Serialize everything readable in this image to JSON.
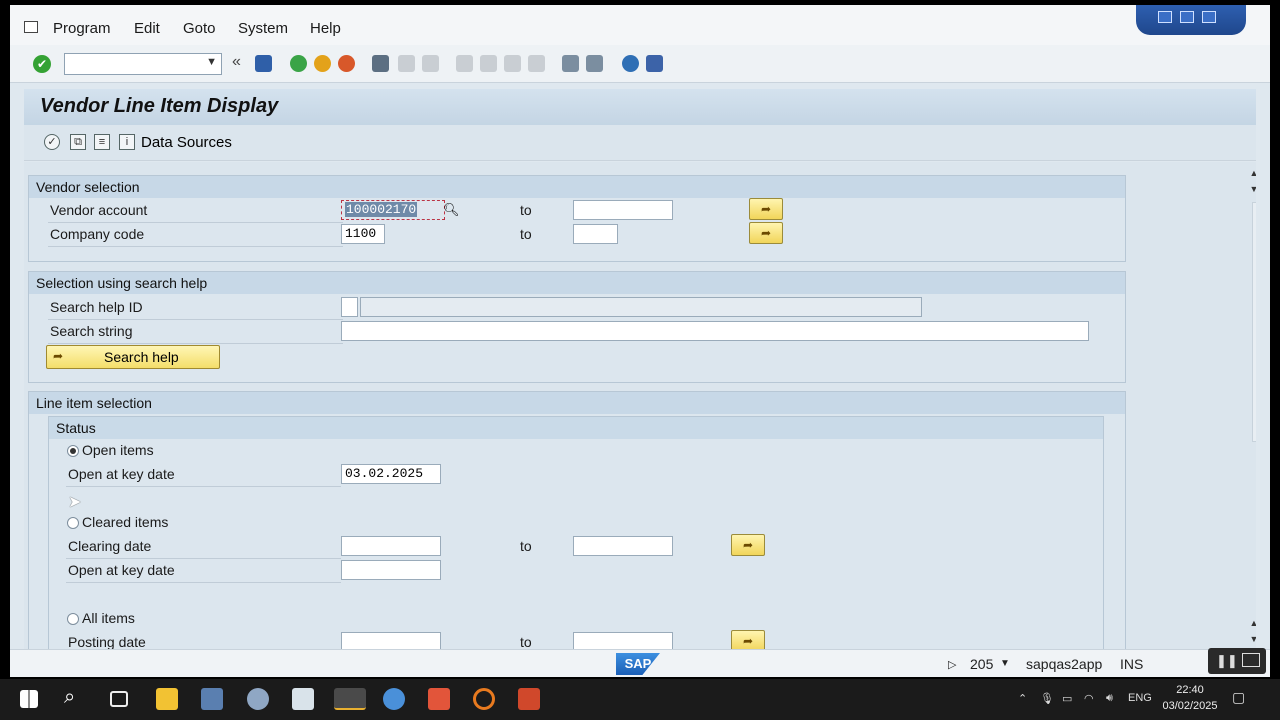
{
  "menu": {
    "items": [
      "Program",
      "Edit",
      "Goto",
      "System",
      "Help"
    ]
  },
  "toolbar": {
    "command_value": "",
    "back_symbol": "«"
  },
  "title": "Vendor Line Item Display",
  "appbar": {
    "data_sources": "Data Sources"
  },
  "vendor_selection": {
    "header": "Vendor selection",
    "vendor_account_label": "Vendor account",
    "vendor_account_value": "100002170",
    "company_code_label": "Company code",
    "company_code_value": "1100",
    "to": "to"
  },
  "search_help_group": {
    "header": "Selection using search help",
    "search_help_id_label": "Search help ID",
    "search_string_label": "Search string",
    "search_help_button": "Search help"
  },
  "line_item_selection": {
    "header": "Line item selection",
    "status_header": "Status",
    "open_items": "Open items",
    "open_at_key_date_label": "Open at key date",
    "open_at_key_date_value": "03.02.2025",
    "cleared_items": "Cleared items",
    "clearing_date_label": "Clearing date",
    "open_at_key_date_label_2": "Open at key date",
    "all_items": "All items",
    "posting_date_label": "Posting date",
    "to": "to",
    "selected_option": "Open items"
  },
  "status_bar": {
    "logo": "SAP",
    "session": "205",
    "server": "sapqas2app",
    "mode": "INS"
  },
  "taskbar": {
    "lang": "ENG",
    "time": "22:40",
    "date": "03/02/2025"
  }
}
